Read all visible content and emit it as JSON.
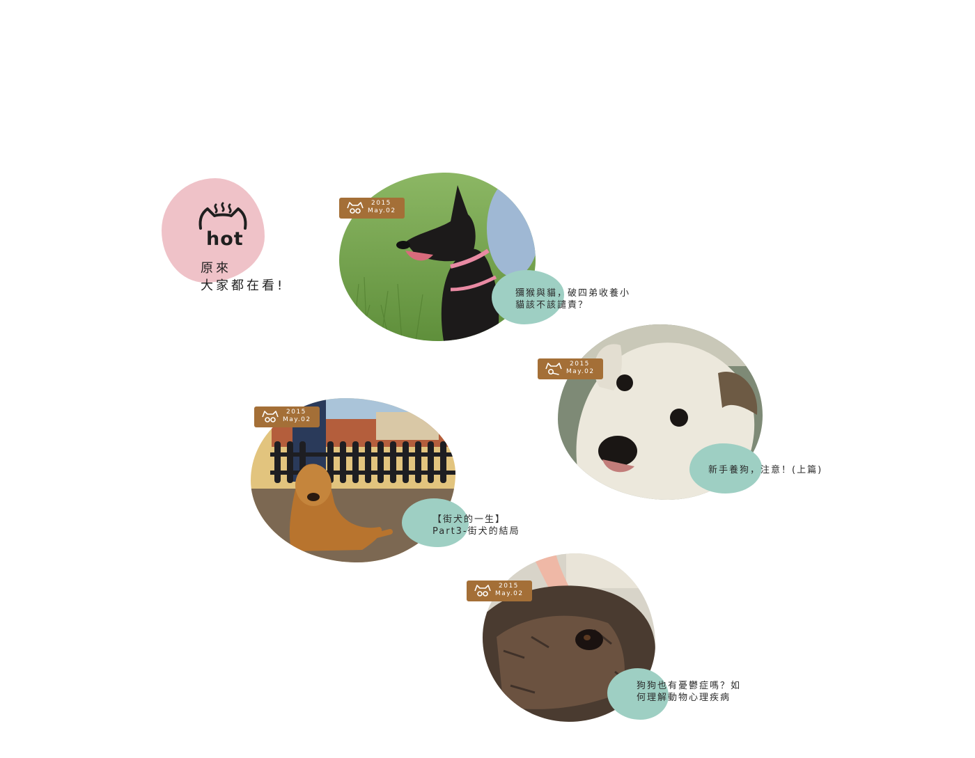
{
  "hot": {
    "word": "hot",
    "line1": "原來",
    "line2": "大家都在看!"
  },
  "colors": {
    "pink": "#efc2c8",
    "teal": "#9ecfc3",
    "tag_brown": "#a46f37"
  },
  "cards": [
    {
      "year": "2015",
      "date": "May.02",
      "title_line1": "獼猴與貓，破四弟收養小",
      "title_line2": "貓該不該譴責？",
      "photo": "black-dog-on-grass"
    },
    {
      "year": "2015",
      "date": "May.02",
      "title_line1": "新手養狗，注意！(上篇)",
      "title_line2": "",
      "photo": "white-dog-closeup"
    },
    {
      "year": "2015",
      "date": "May.02",
      "title_line1": "【街犬的一生】",
      "title_line2": "Part3-街犬的結局",
      "photo": "golden-dog-lying"
    },
    {
      "year": "2015",
      "date": "May.02",
      "title_line1": "狗狗也有憂鬱症嗎？如",
      "title_line2": "何理解動物心理疾病",
      "photo": "brindle-dog-eye"
    }
  ]
}
